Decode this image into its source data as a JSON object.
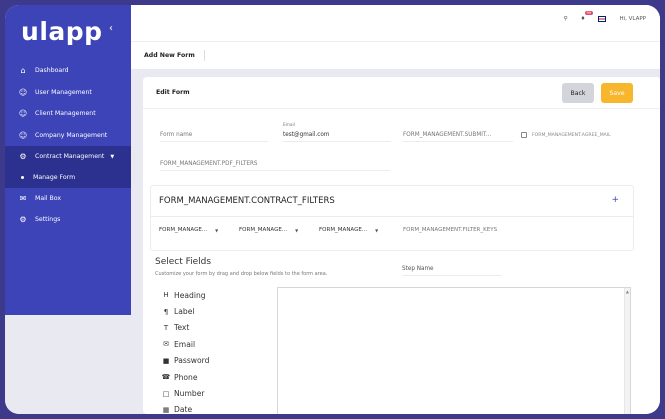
{
  "app": {
    "logo": "lapp",
    "logo_u": "u"
  },
  "sidebar": {
    "items": [
      {
        "label": "Dashboard",
        "icon": "home-icon"
      },
      {
        "label": "User Management",
        "icon": "user-icon"
      },
      {
        "label": "Client Management",
        "icon": "user-icon"
      },
      {
        "label": "Company Management",
        "icon": "user-icon"
      },
      {
        "label": "Contract Management",
        "icon": "gear-icon"
      },
      {
        "label": "Mail Box",
        "icon": "mail-icon"
      },
      {
        "label": "Settings",
        "icon": "gear-icon"
      }
    ],
    "subitem": "Manage Form"
  },
  "topbar": {
    "badge": "99",
    "greeting": "Hi, VLAPP"
  },
  "breadcrumb": {
    "title": "Add New Form"
  },
  "card": {
    "title": "Edit Form",
    "back_label": "Back",
    "save_label": "Save"
  },
  "form": {
    "form_name": "Form name",
    "email_label": "Email",
    "email_value": "test@gmail.com",
    "submit_field": "FORM_MANAGEMENT.SUBMIT...",
    "agree_label": "FORM_MANAGEMENT.AGREE_MAIL",
    "pdf_filters": "FORM_MANAGEMENT.PDF_FILTERS"
  },
  "filters": {
    "title": "FORM_MANAGEMENT.CONTRACT_FILTERS",
    "plus": "+",
    "dropdowns": [
      "FORM_MANAGE...",
      "FORM_MANAGE...",
      "FORM_MANAGE..."
    ],
    "filter_keys": "FORM_MANAGEMENT.FILTER_KEYS"
  },
  "select_fields": {
    "title": "Select Fields",
    "subtitle": "Customize your form by drag and drop below fields to the form area.",
    "step_name": "Step Name",
    "palette": [
      {
        "label": "Heading",
        "icon": "heading-icon"
      },
      {
        "label": "Label",
        "icon": "paragraph-icon"
      },
      {
        "label": "Text",
        "icon": "text-icon"
      },
      {
        "label": "Email",
        "icon": "envelope-icon"
      },
      {
        "label": "Password",
        "icon": "lock-icon"
      },
      {
        "label": "Phone",
        "icon": "phone-icon"
      },
      {
        "label": "Number",
        "icon": "number-icon"
      },
      {
        "label": "Date",
        "icon": "calendar-icon"
      }
    ]
  },
  "colors": {
    "sidebar": "#3c44b8",
    "sidebar_active": "#2c318f",
    "save": "#f8b62d",
    "back": "#d4d5db"
  }
}
